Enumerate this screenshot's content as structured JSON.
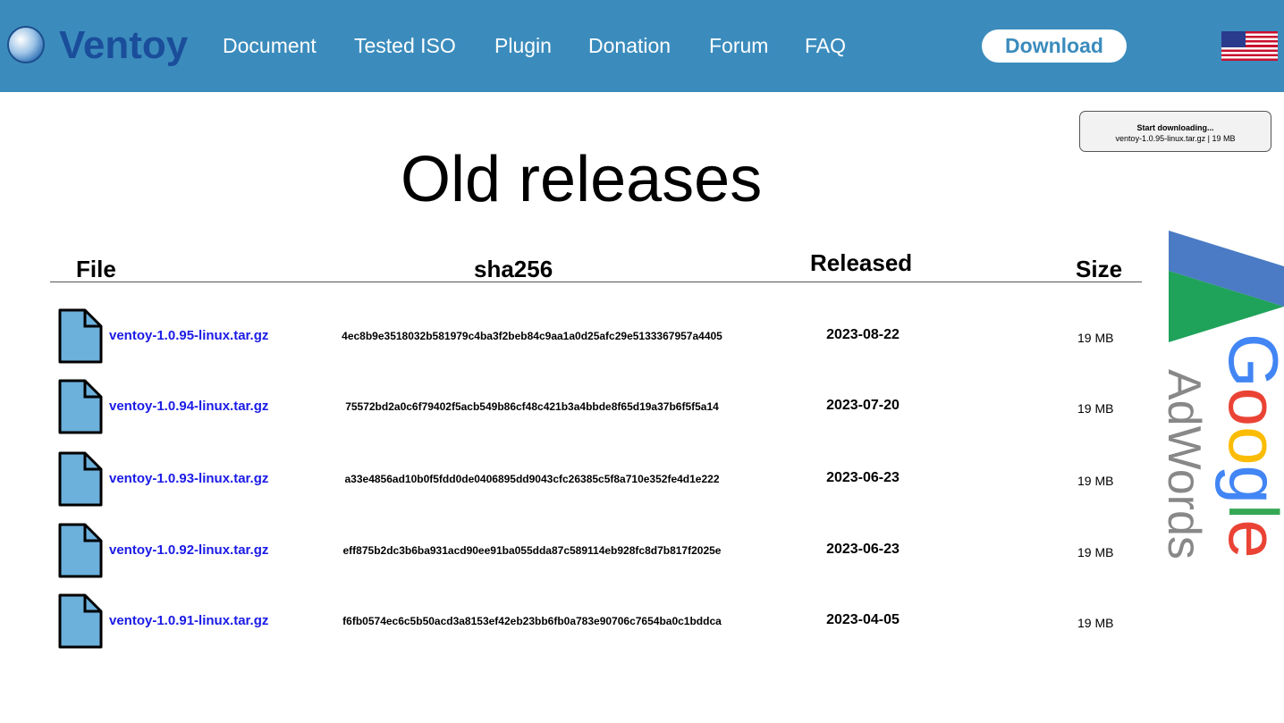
{
  "header": {
    "logo": "Ventoy",
    "nav": [
      "Document",
      "Tested ISO",
      "Plugin",
      "Donation",
      "Forum",
      "FAQ"
    ],
    "download": "Download",
    "flag": "us-flag-icon"
  },
  "toast": {
    "title": "Start downloading...",
    "detail": "ventoy-1.0.95-linux.tar.gz | 19 MB"
  },
  "page": {
    "title": "Old releases"
  },
  "table": {
    "headers": [
      "File",
      "sha256",
      "Released",
      "Size"
    ],
    "rows": [
      {
        "file": "ventoy-1.0.95-linux.tar.gz",
        "sha256": "4ec8b9e3518032b581979c4ba3f2beb84c9aa1a0d25afc29e5133367957a4405",
        "released": "2023-08-22",
        "size": "19 MB"
      },
      {
        "file": "ventoy-1.0.94-linux.tar.gz",
        "sha256": "75572bd2a0c6f79402f5acb549b86cf48c421b3a4bbde8f65d19a37b6f5f5a14",
        "released": "2023-07-20",
        "size": "19 MB"
      },
      {
        "file": "ventoy-1.0.93-linux.tar.gz",
        "sha256": "a33e4856ad10b0f5fdd0de0406895dd9043cfc26385c5f8a710e352fe4d1e222",
        "released": "2023-06-23",
        "size": "19 MB"
      },
      {
        "file": "ventoy-1.0.92-linux.tar.gz",
        "sha256": "eff875b2dc3b6ba931acd90ee91ba055dda87c589114eb928fc8d7b817f2025e",
        "released": "2023-06-23",
        "size": "19 MB"
      },
      {
        "file": "ventoy-1.0.91-linux.tar.gz",
        "sha256": "f6fb0574ec6c5b50acd3a8153ef42eb23bb6fb0a783e90706c7654ba0c1bddca",
        "released": "2023-04-05",
        "size": "19 MB"
      }
    ]
  },
  "ad": {
    "brand": "Google",
    "product": "AdWords"
  }
}
